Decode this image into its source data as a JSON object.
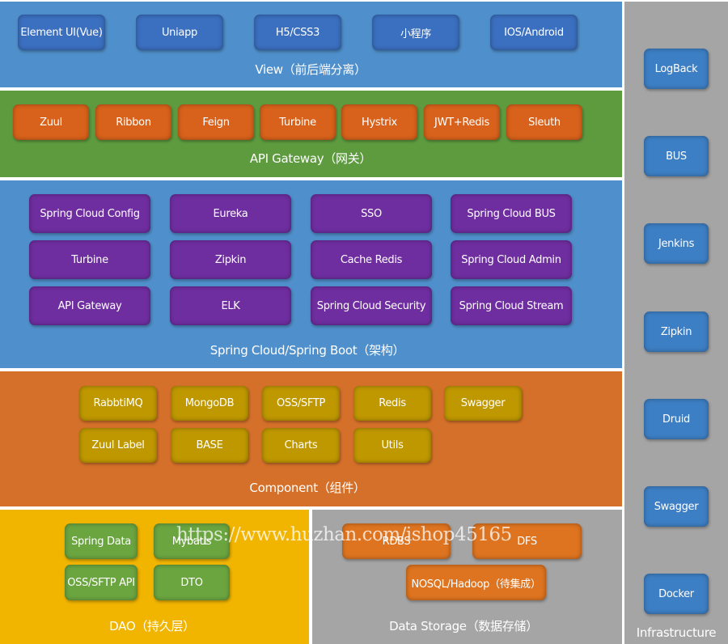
{
  "colors": {
    "view": "#4f8fcb",
    "view_box": "#3b6fbf",
    "api": "#5e9b3f",
    "api_box": "#d8621b",
    "cloud": "#4f8fcb",
    "cloud_box": "#6f2ea0",
    "component": "#d5702a",
    "component_box": "#bf9800",
    "dao": "#f1b500",
    "dao_box": "#6ba540",
    "storage": "#a5a5a5",
    "storage_box": "#de7420",
    "infra": "#a5a5a5",
    "infra_box": "#3d7fc4"
  },
  "view": {
    "title": "View（前后端分离）",
    "items": [
      "Element UI(Vue)",
      "Uniapp",
      "H5/CSS3",
      "小程序",
      "IOS/Android"
    ]
  },
  "api_gateway": {
    "title": "API Gateway（网关）",
    "items": [
      "Zuul",
      "Ribbon",
      "Feign",
      "Turbine",
      "Hystrix",
      "JWT+Redis",
      "Sleuth"
    ]
  },
  "spring_cloud": {
    "title": "Spring Cloud/Spring Boot（架构）",
    "items": [
      "Spring Cloud Config",
      "Eureka",
      "SSO",
      "Spring Cloud BUS",
      "Turbine",
      "Zipkin",
      "Cache Redis",
      "Spring Cloud Admin",
      "API Gateway",
      "ELK",
      "Spring Cloud Security",
      "Spring Cloud Stream"
    ]
  },
  "component": {
    "title": "Component（组件）",
    "items": [
      "RabbtiMQ",
      "MongoDB",
      "OSS/SFTP",
      "Redis",
      "Swagger",
      "Zuul Label",
      "BASE",
      "Charts",
      "Utils"
    ]
  },
  "dao": {
    "title": "DAO（持久层）",
    "items": [
      "Spring Data",
      "Mybatis",
      "OSS/SFTP API",
      "DTO"
    ]
  },
  "data_storage": {
    "title": "Data Storage（数据存储）",
    "items": [
      "RDBS",
      "DFS",
      "NOSQL/Hadoop（待集成）"
    ]
  },
  "infrastructure": {
    "title": "Infrastructure",
    "items": [
      "LogBack",
      "BUS",
      "Jenkins",
      "Zipkin",
      "Druid",
      "Swagger",
      "Docker"
    ]
  },
  "watermark": "https://www.huzhan.com/ishop45165"
}
